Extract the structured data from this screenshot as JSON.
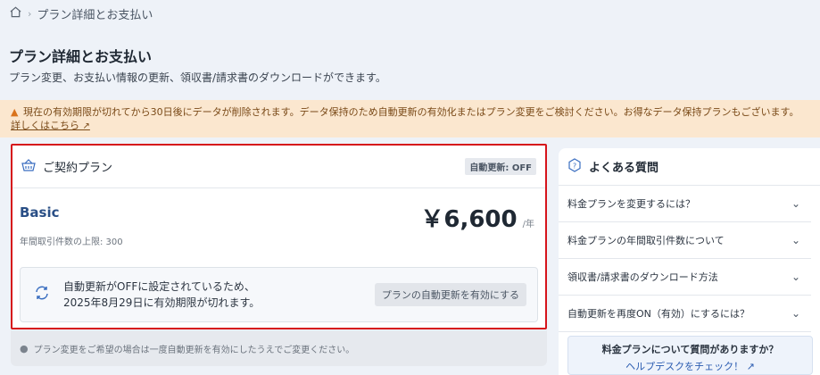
{
  "breadcrumb": {
    "home_icon": "home-icon",
    "separator": "›",
    "current": "プラン詳細とお支払い"
  },
  "page": {
    "title": "プラン詳細とお支払い",
    "description": "プラン変更、お支払い情報の更新、領収書/請求書のダウンロードができます。"
  },
  "warning": {
    "icon": "warning-icon",
    "text": "現在の有効期限が切れてから30日後にデータが削除されます。データ保持のため自動更新の有効化またはプラン変更をご検討ください。お得なデータ保持プランもございます。",
    "link": "詳しくはこちら",
    "link_icon": "external-link-icon",
    "color": "#fbe7cf"
  },
  "plan": {
    "header_icon": "basket-icon",
    "header_title": "ご契約プラン",
    "auto_renew_badge": "自動更新: OFF",
    "name": "Basic",
    "price": "￥6,600",
    "price_unit": "/年",
    "limit": "年間取引件数の上限: 300",
    "notice": {
      "icon": "sync-icon",
      "line1": "自動更新がOFFに設定されているため、",
      "line2": "2025年8月29日に有効期限が切れます。",
      "button": "プランの自動更新を有効にする"
    },
    "footer_icon": "info-icon",
    "footer_note": "プラン変更をご希望の場合は一度自動更新を有効にしたうえでご変更ください。",
    "highlight_color": "#d6141b"
  },
  "faq": {
    "icon": "question-icon",
    "title": "よくある質問",
    "items": [
      {
        "label": "料金プランを変更するには？"
      },
      {
        "label": "料金プランの年間取引件数について"
      },
      {
        "label": "領収書/請求書のダウンロード方法"
      },
      {
        "label": "自動更新を再度ON（有効）にするには？"
      }
    ],
    "help_question": "料金プランについて質問がありますか？",
    "help_link": "ヘルプデスクをチェック！"
  }
}
